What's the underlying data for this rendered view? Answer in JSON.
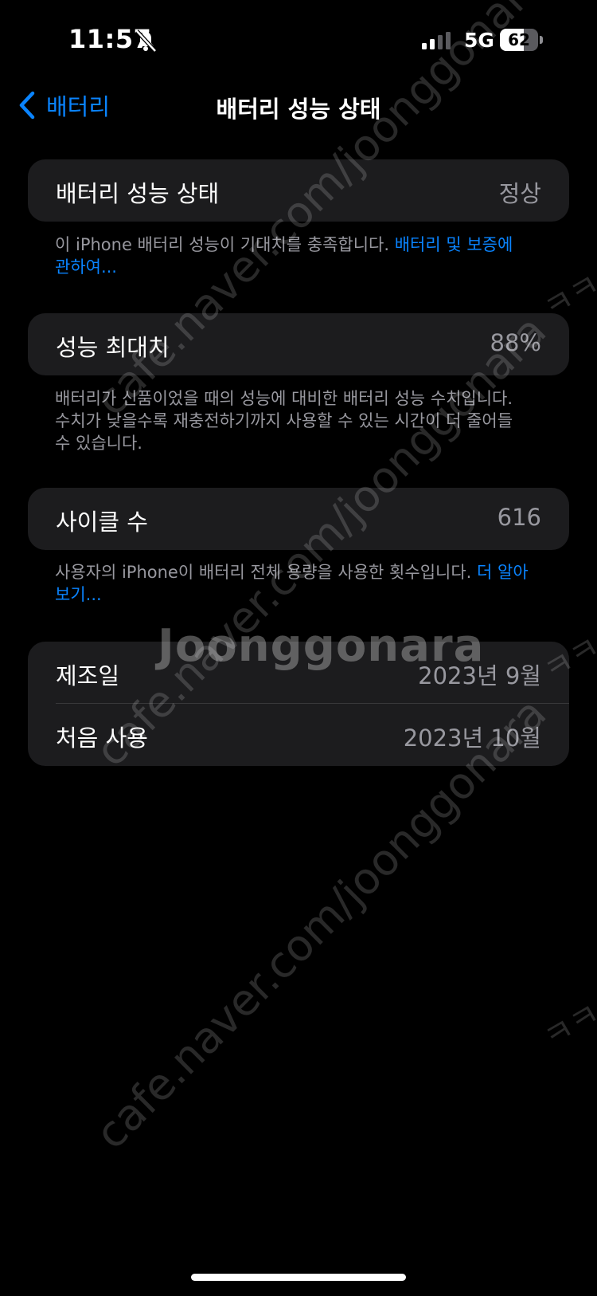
{
  "status_bar": {
    "time": "11:57",
    "network": "5G",
    "battery_percent": 62,
    "battery_label": "62"
  },
  "nav": {
    "back_label": "배터리",
    "title": "배터리 성능 상태"
  },
  "sections": {
    "health": {
      "label": "배터리 성능 상태",
      "value": "정상",
      "footer_text": "이 iPhone 배터리 성능이 기대치를 충족합니다. ",
      "footer_link": "배터리 및 보증에 관하여..."
    },
    "max_capacity": {
      "label": "성능 최대치",
      "value": "88%",
      "footer_text": "배터리가 신품이었을 때의 성능에 대비한 배터리 성능 수치입니다. 수치가 낮을수록 재충전하기까지 사용할 수 있는 시간이 더 줄어들 수 있습니다."
    },
    "cycle_count": {
      "label": "사이클 수",
      "value": "616",
      "footer_text": "사용자의 iPhone이 배터리 전체 용량을 사용한 횟수입니다. ",
      "footer_link": "더 알아보기..."
    },
    "dates": {
      "manufacture_label": "제조일",
      "manufacture_value": "2023년 9월",
      "first_use_label": "처음 사용",
      "first_use_value": "2023년 10월"
    }
  },
  "watermark": {
    "site": "cafe.naver.com/joonggonara",
    "logo": "Joonggonara",
    "mark": "ㅋㅋ"
  },
  "colors": {
    "accent": "#0a84ff",
    "background": "#000000",
    "cell": "#1c1c1e",
    "secondary_text": "#98989f"
  }
}
